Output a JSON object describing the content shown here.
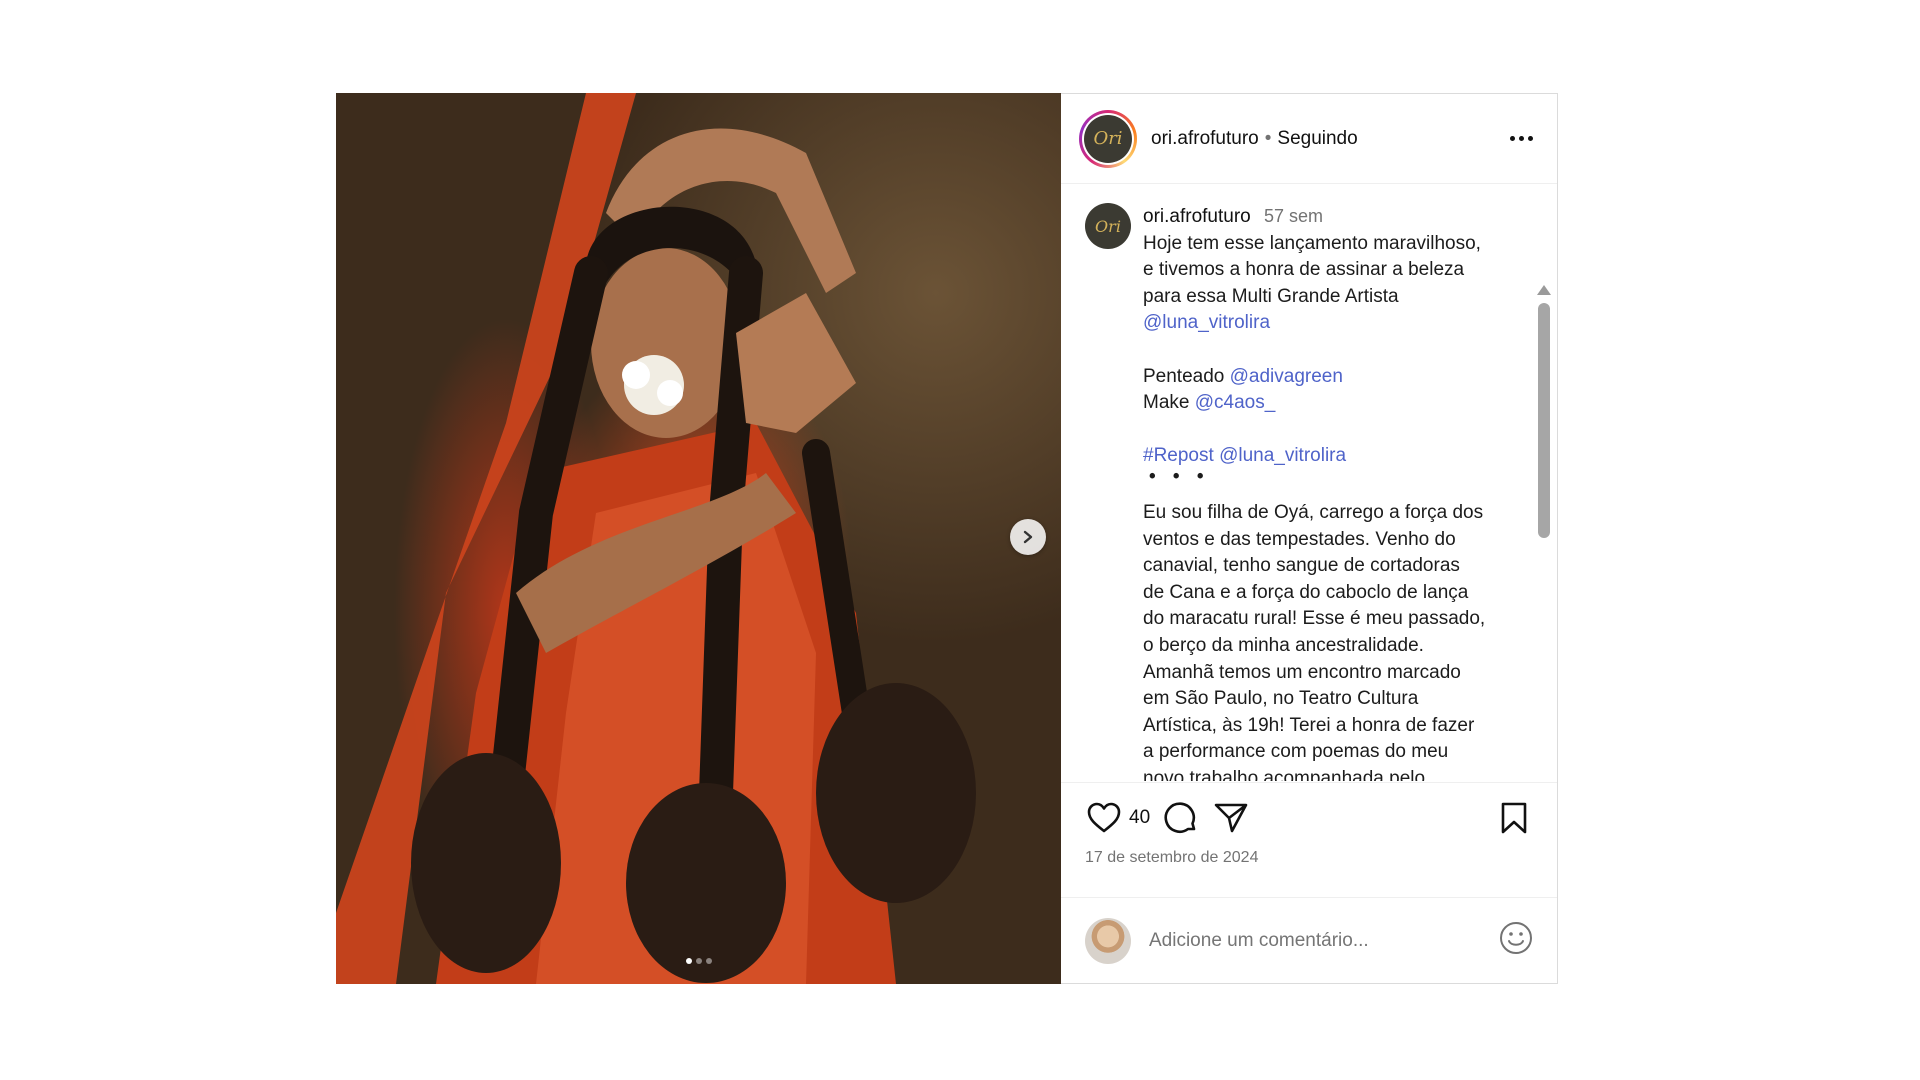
{
  "post": {
    "username": "ori.afrofuturo",
    "separator": "•",
    "follow_status": "Seguindo",
    "avatar_text": "Ori"
  },
  "caption": {
    "username": "ori.afrofuturo",
    "time": "57 sem",
    "line1": "Hoje tem esse lançamento maravilhoso,",
    "line2": "e tivemos a honra de assinar a beleza",
    "line3": "para essa Multi Grande Artista",
    "mention_artist": "@luna_vitrolira",
    "penteado_label": "Penteado",
    "penteado_mention": "@adivagreen",
    "make_label": "Make",
    "make_mention": "@c4aos_",
    "repost_tag": "#Repost",
    "repost_mention": "@luna_vitrolira",
    "dots": "• • •",
    "body_lines": [
      "Eu sou filha de Oyá, carrego a força dos",
      "ventos e das tempestades. Venho do",
      "canavial, tenho sangue de cortadoras",
      "de Cana e a força do caboclo de lança",
      "do maracatu rural! Esse é meu passado,",
      "o berço  da minha ancestralidade.",
      "Amanhã temos um encontro marcado",
      "em São Paulo, no Teatro Cultura",
      "Artística, às 19h! Terei a honra de fazer",
      "a performance com poemas do meu",
      "novo trabalho acompanhada pelo"
    ]
  },
  "actions": {
    "likes": "40",
    "date": "17 de setembro de 2024"
  },
  "comment_box": {
    "placeholder": "Adicione um comentário..."
  },
  "carousel": {
    "total": 3,
    "active_index": 0
  },
  "icons": [
    "more-icon",
    "heart-icon",
    "comment-icon",
    "share-icon",
    "bookmark-icon",
    "emoji-icon",
    "chevron-right-icon"
  ]
}
